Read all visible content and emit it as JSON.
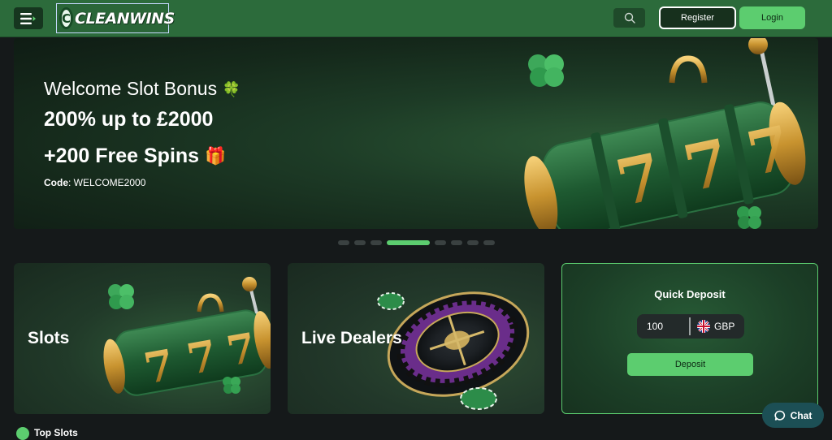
{
  "header": {
    "logo_text": "CLEANWINS",
    "register_label": "Register",
    "login_label": "Login"
  },
  "hero": {
    "title": "Welcome Slot Bonus",
    "title_emoji": "🍀",
    "line1": "200% up to £2000",
    "line2": "+200 Free Spins",
    "line2_emoji": "🎁",
    "code_label": "Code",
    "code_value": ": WELCOME2000"
  },
  "carousel": {
    "total": 8,
    "active_index": 3
  },
  "cards": {
    "slots_label": "Slots",
    "live_label": "Live Dealers"
  },
  "quick_deposit": {
    "title": "Quick Deposit",
    "amount_value": "100",
    "currency": "GBP",
    "button_label": "Deposit"
  },
  "chat": {
    "label": "Chat"
  },
  "bottom": {
    "label": "Top Slots"
  },
  "colors": {
    "accent": "#5ccd6f",
    "header": "#2c6b3b",
    "background": "#15191a"
  }
}
